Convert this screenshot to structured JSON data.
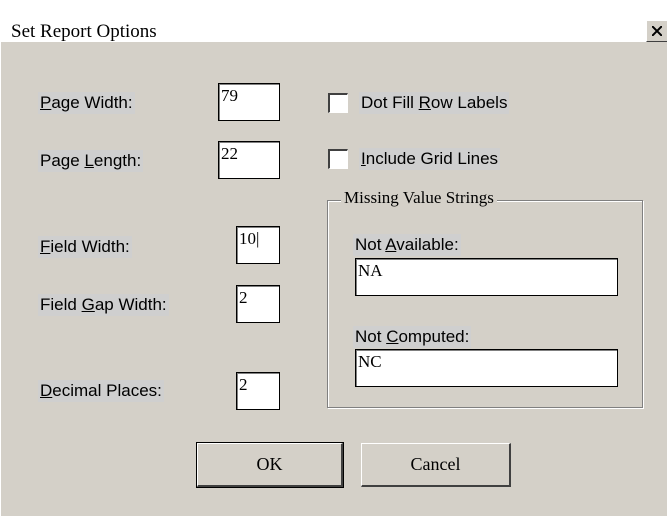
{
  "window": {
    "title": "Set Report Options",
    "close_glyph": "close-icon"
  },
  "fields": {
    "page_width": {
      "label_pre": "",
      "label_key": "P",
      "label_post": "age Width:",
      "value": "79"
    },
    "page_length": {
      "label_pre": "Page ",
      "label_key": "L",
      "label_post": "ength:",
      "value": "22"
    },
    "field_width": {
      "label_pre": "",
      "label_key": "F",
      "label_post": "ield Width:",
      "value": "10|"
    },
    "field_gap_width": {
      "label_pre": "Field ",
      "label_key": "G",
      "label_post": "ap Width:",
      "value": "2"
    },
    "decimal_places": {
      "label_pre": "",
      "label_key": "D",
      "label_post": "ecimal Places:",
      "value": "2"
    }
  },
  "checkboxes": {
    "dot_fill": {
      "label_pre": "Dot Fill ",
      "label_key": "R",
      "label_post": "ow Labels",
      "checked": false
    },
    "grid_lines": {
      "label_pre": "",
      "label_key": "I",
      "label_post": "nclude Grid Lines",
      "checked": false
    }
  },
  "missing_values": {
    "group_title": "Missing Value Strings",
    "not_available": {
      "label_pre": "Not ",
      "label_key": "A",
      "label_post": "vailable:",
      "value": "NA"
    },
    "not_computed": {
      "label_pre": "Not ",
      "label_key": "C",
      "label_post": "omputed:",
      "value": "NC"
    }
  },
  "buttons": {
    "ok": "OK",
    "cancel": "Cancel"
  }
}
